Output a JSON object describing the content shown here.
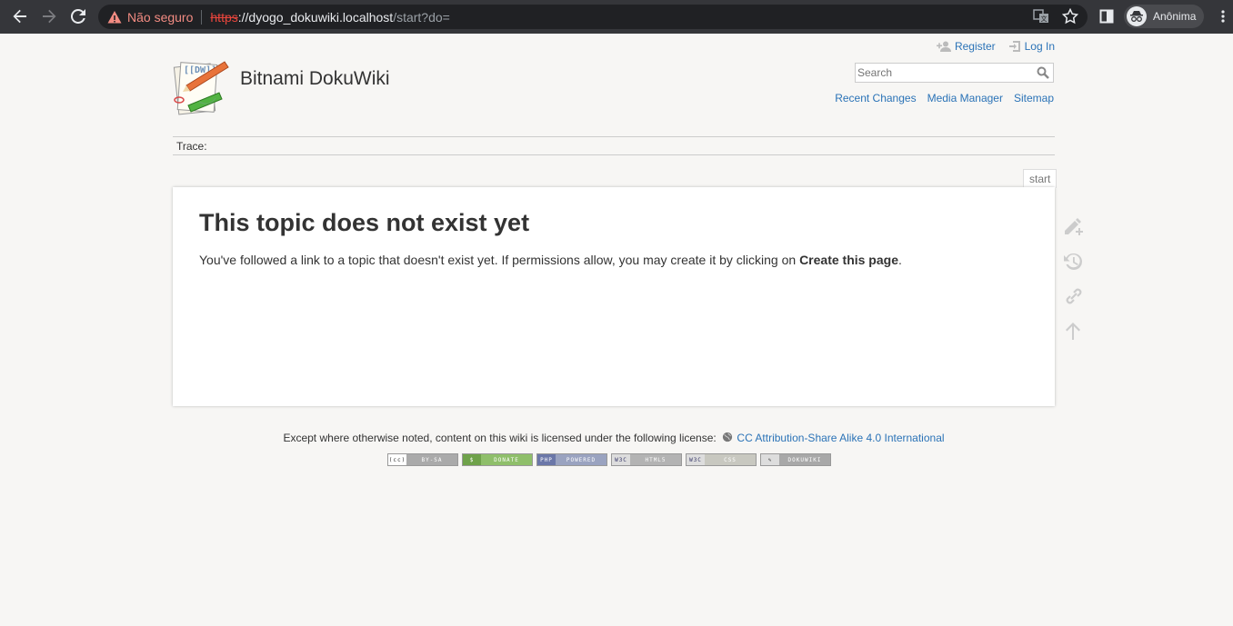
{
  "browser": {
    "security_label": "Não seguro",
    "url_proto": "https",
    "url_host": "://dyogo_dokuwiki.localhost",
    "url_path": "/start?do=",
    "profile_label": "Anônima"
  },
  "header": {
    "site_title": "Bitnami DokuWiki",
    "user_tools": {
      "register": "Register",
      "login": "Log In"
    },
    "search_placeholder": "Search",
    "site_tools": {
      "recent": "Recent Changes",
      "media": "Media Manager",
      "sitemap": "Sitemap"
    }
  },
  "breadcrumbs": {
    "trace_label": "Trace:"
  },
  "page": {
    "id": "start",
    "title": "This topic does not exist yet",
    "body_text": "You've followed a link to a topic that doesn't exist yet. If permissions allow, you may create it by clicking on ",
    "body_bold": "Create this page",
    "body_end": "."
  },
  "footer": {
    "license_text": "Except where otherwise noted, content on this wiki is licensed under the following license:",
    "license_link": "CC Attribution-Share Alike 4.0 International",
    "badges": {
      "ccbysa": "BY-SA",
      "donate": "DONATE",
      "php": "POWERED",
      "html5": "HTML5",
      "css": "CSS",
      "dokuwiki": "DOKUWIKI"
    }
  },
  "colors": {
    "link": "#2b73b7",
    "chrome_bg": "#35363a",
    "page_bg": "#f7f6f4"
  }
}
